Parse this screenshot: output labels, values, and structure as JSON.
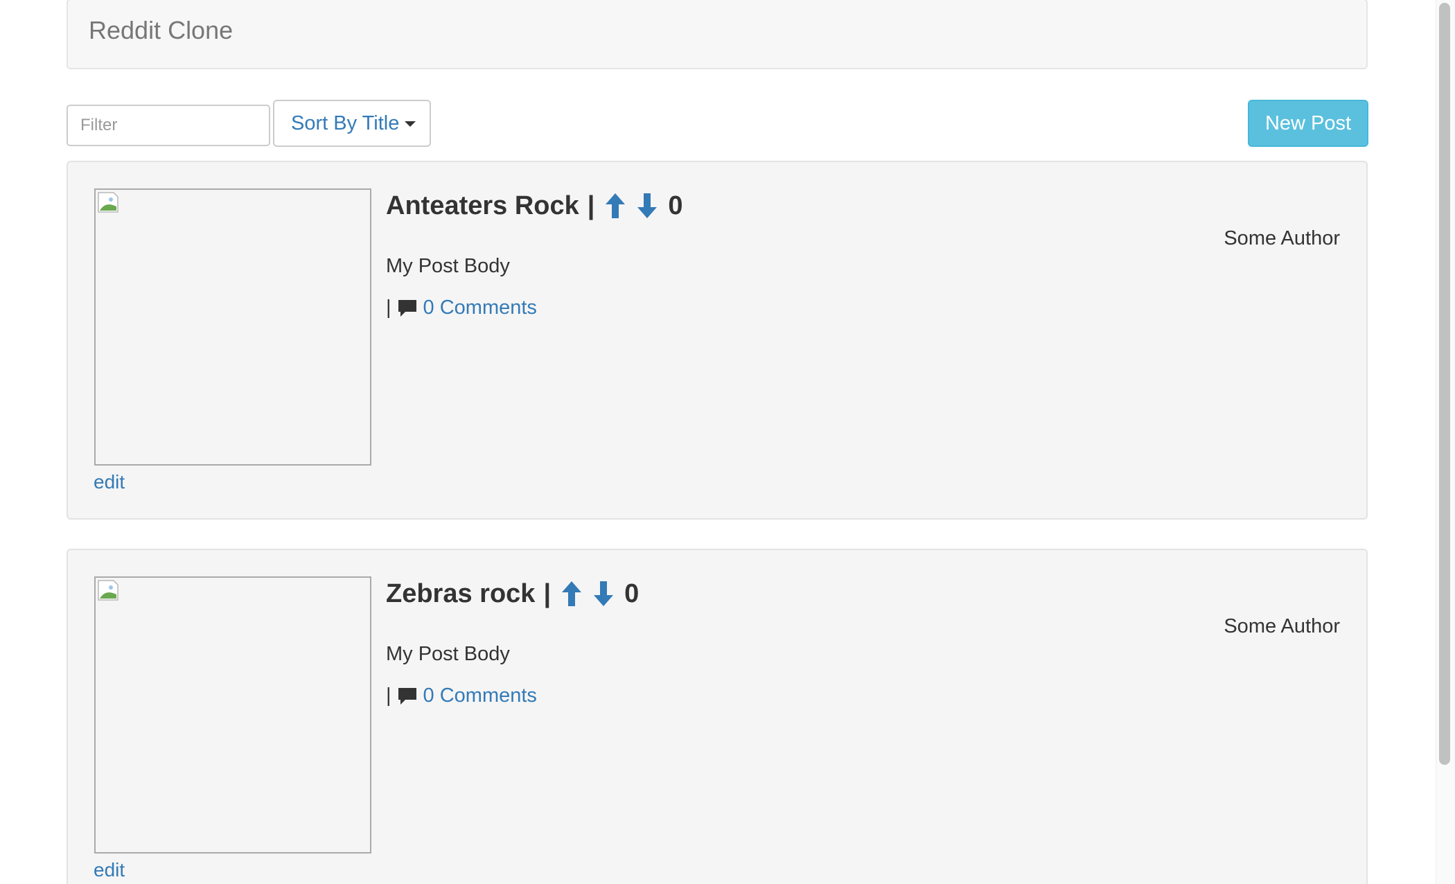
{
  "navbar": {
    "brand": "Reddit Clone"
  },
  "toolbar": {
    "filter_placeholder": "Filter",
    "sort_label": "Sort By Title",
    "new_post_label": "New Post"
  },
  "posts": [
    {
      "title": "Anteaters Rock",
      "separator": "|",
      "score": "0",
      "author": "Some Author",
      "body": "My Post Body",
      "comments_pipe": "|",
      "comments_label": "0 Comments",
      "edit_label": "edit"
    },
    {
      "title": "Zebras rock",
      "separator": "|",
      "score": "0",
      "author": "Some Author",
      "body": "My Post Body",
      "comments_pipe": "|",
      "comments_label": "0 Comments",
      "edit_label": "edit"
    }
  ],
  "icons": {
    "upvote": "arrow-up-icon",
    "downvote": "arrow-down-icon",
    "comment": "comment-icon",
    "caret": "caret-down-icon",
    "broken_image": "broken-image-icon"
  },
  "colors": {
    "link": "#337ab7",
    "info_button": "#5bc0de",
    "card_bg": "#f5f5f5",
    "navbar_bg": "#f7f7f7"
  }
}
